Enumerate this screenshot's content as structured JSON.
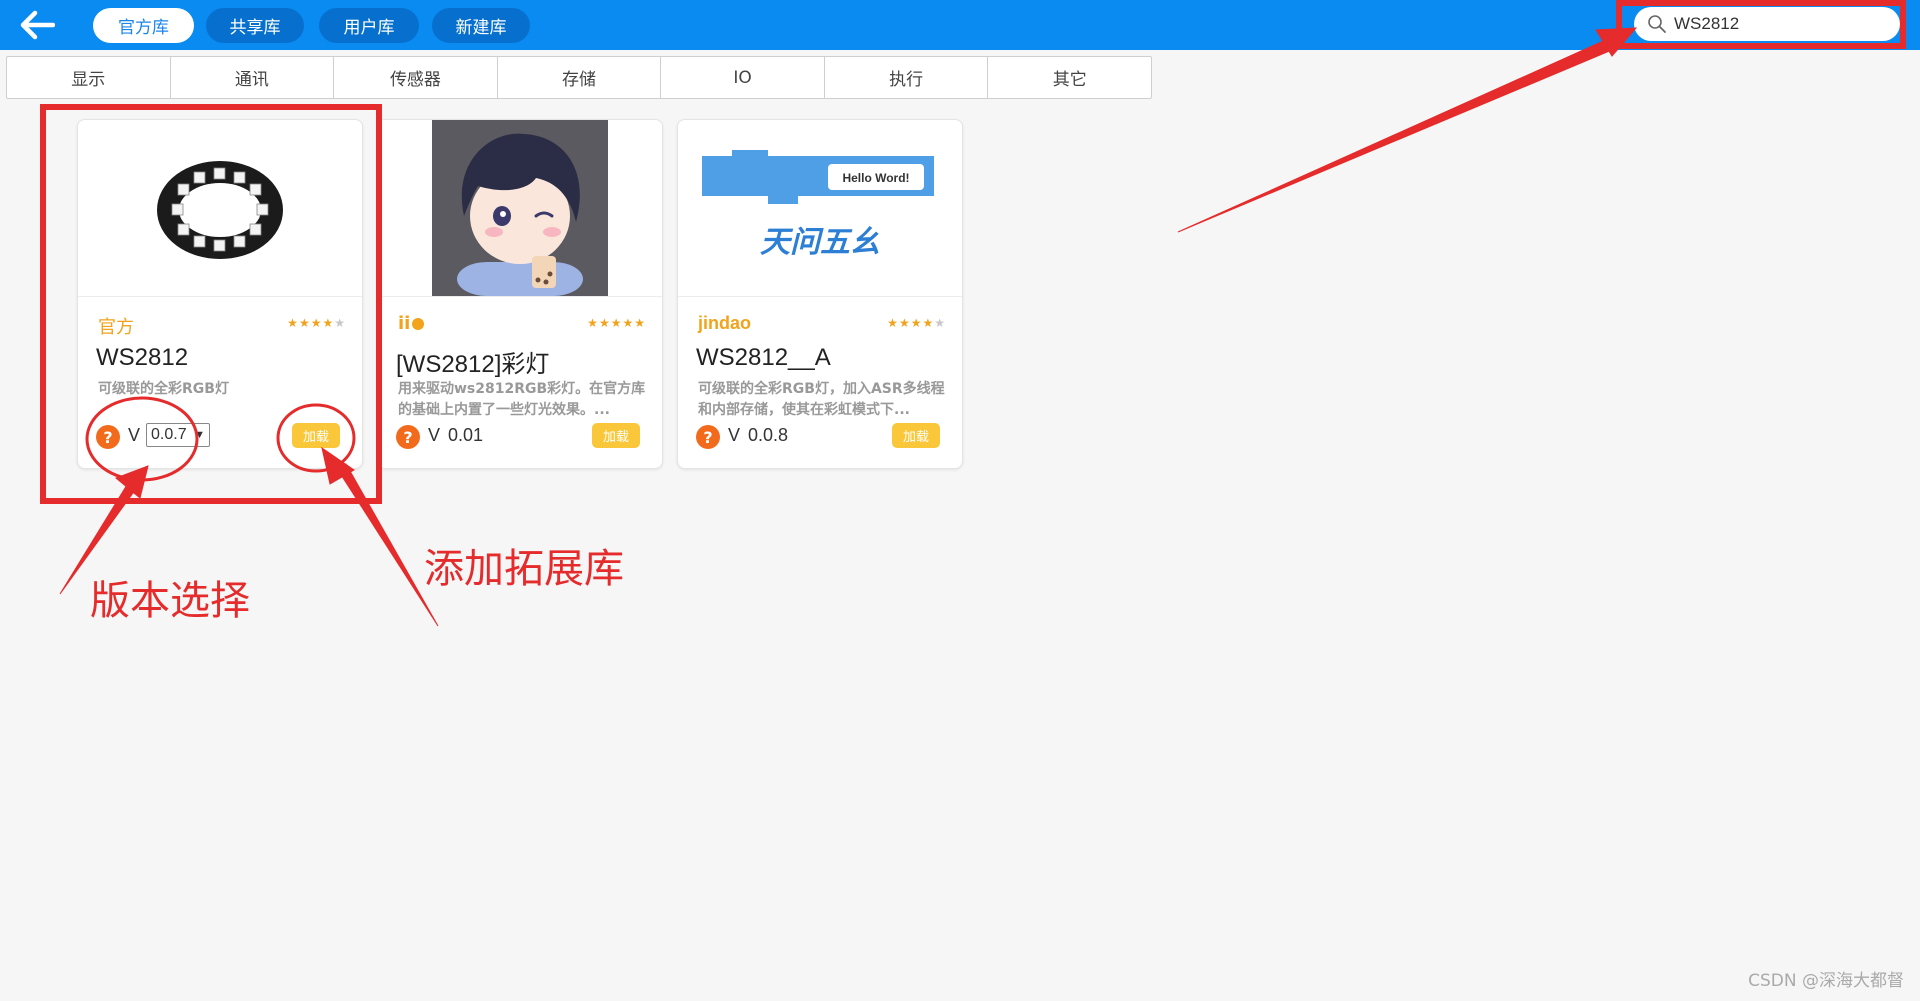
{
  "topbar": {
    "tabs": [
      {
        "label": "官方库",
        "active": true
      },
      {
        "label": "共享库",
        "active": false
      },
      {
        "label": "用户库",
        "active": false
      },
      {
        "label": "新建库",
        "active": false
      }
    ],
    "search": {
      "value": "WS2812"
    },
    "colors": {
      "bar": "#0a8bf2",
      "tab": "#0770cf"
    }
  },
  "categories": [
    "显示",
    "通讯",
    "传感器",
    "存储",
    "IO",
    "执行",
    "其它"
  ],
  "cards": [
    {
      "author": "官方",
      "rating": 4.5,
      "name": "WS2812",
      "description": "可级联的全彩RGB灯",
      "help": "?",
      "version_prefix": "V",
      "version": "0.0.7",
      "has_version_select": true,
      "load_label": "加载",
      "image_icon": "led-ring-icon"
    },
    {
      "author": "ii",
      "rating": 5,
      "name": "[WS2812]彩灯",
      "description": "用来驱动ws2812RGB彩灯。在官方库的基础上内置了一些灯光效果。...",
      "help": "?",
      "version_prefix": "V",
      "version": "0.01",
      "has_version_select": false,
      "load_label": "加载",
      "image_icon": "anime-avatar-icon"
    },
    {
      "author": "jindao",
      "rating": 4,
      "name": "WS2812__A",
      "description": "可级联的全彩RGB灯，加入ASR多线程和内部存储，使其在彩虹模式下...",
      "help": "?",
      "version_prefix": "V",
      "version": "0.0.8",
      "has_version_select": false,
      "load_label": "加载",
      "image_icon": "hello-word-block-icon",
      "image_text": "Hello Word!"
    }
  ],
  "annotations": {
    "version_select_label": "版本选择",
    "add_library_label": "添加拓展库",
    "color": "#e52b2b"
  },
  "watermark": "CSDN @深海大都督"
}
